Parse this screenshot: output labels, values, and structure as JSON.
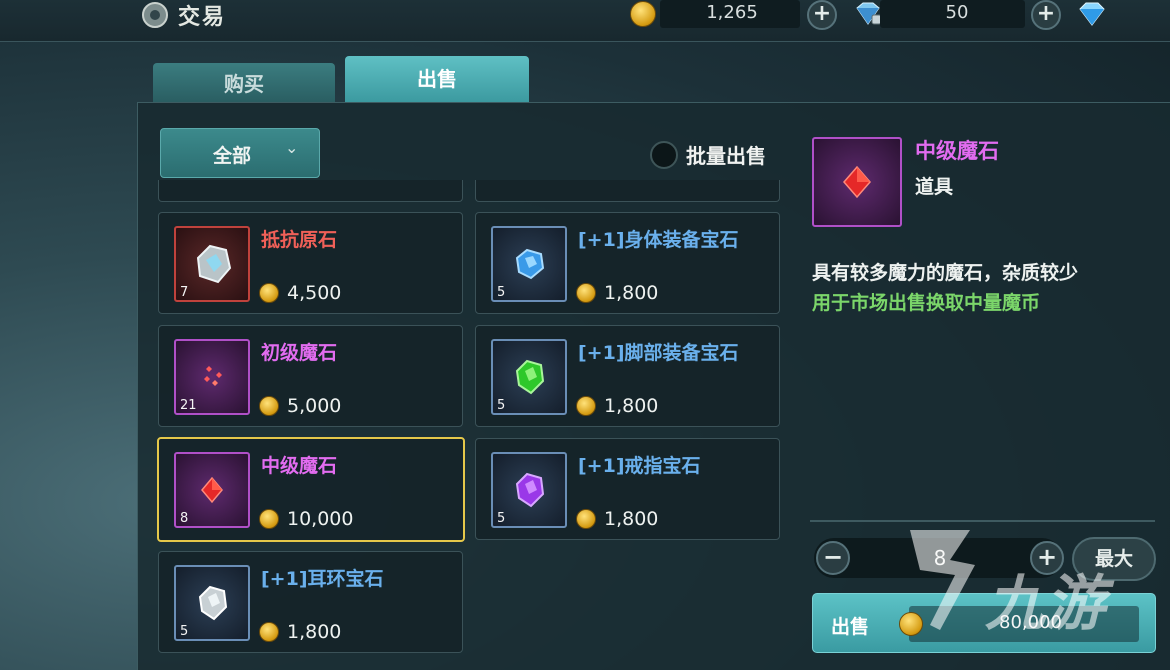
{
  "header": {
    "title": "交易",
    "gold_amount": "1,265",
    "gem_amount": "50",
    "gold_icon": "gold-coin-icon",
    "gem_icon": "diamond-icon"
  },
  "tabs": [
    {
      "label": "购买",
      "active": false
    },
    {
      "label": "出售",
      "active": true
    }
  ],
  "filter": {
    "selected": "全部"
  },
  "bulk_sell": {
    "label": "批量出售",
    "checked": false
  },
  "items": [
    {
      "name": "抵抗原石",
      "count": "7",
      "price": "4,500",
      "rarity": "red"
    },
    {
      "name": "[+1]身体装备宝石",
      "count": "5",
      "price": "1,800",
      "rarity": "blue"
    },
    {
      "name": "初级魔石",
      "count": "21",
      "price": "5,000",
      "rarity": "purple"
    },
    {
      "name": "[+1]脚部装备宝石",
      "count": "5",
      "price": "1,800",
      "rarity": "blue"
    },
    {
      "name": "中级魔石",
      "count": "8",
      "price": "10,000",
      "rarity": "purple",
      "selected": true
    },
    {
      "name": "[+1]戒指宝石",
      "count": "5",
      "price": "1,800",
      "rarity": "blue"
    },
    {
      "name": "[+1]耳环宝石",
      "count": "5",
      "price": "1,800",
      "rarity": "blue"
    }
  ],
  "detail": {
    "name": "中级魔石",
    "type": "道具",
    "description": "具有较多魔力的魔石，杂质较少",
    "usage": "用于市场出售换取中量魔币"
  },
  "quantity": {
    "value": "8",
    "max_label": "最大"
  },
  "sell": {
    "label": "出售",
    "total": "80,000"
  },
  "watermark": {
    "text": "九游"
  },
  "colors": {
    "accent_teal": "#4fb4b8",
    "rarity_red": "#f06058",
    "rarity_purple": "#e26cf0",
    "rarity_blue": "#6ab0ec",
    "usage_green": "#7bd66a",
    "selected_border": "#e5c84a"
  }
}
